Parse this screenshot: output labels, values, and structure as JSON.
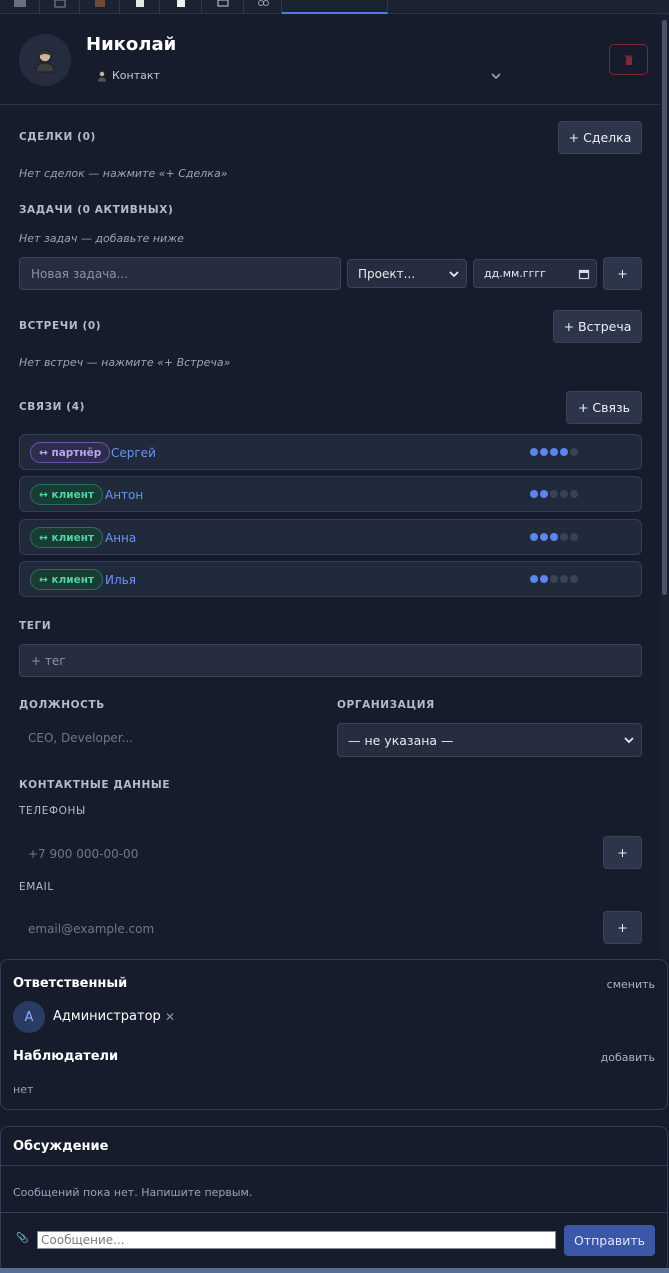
{
  "contact": {
    "name": "Николай",
    "type_label": "Контакт"
  },
  "deals": {
    "label": "СДЕЛКИ (0)",
    "add_button": "+ Сделка",
    "empty": "Нет сделок — нажмите «+ Сделка»"
  },
  "tasks": {
    "label": "ЗАДАЧИ (0 АКТИВНЫХ)",
    "empty": "Нет задач — добавьте ниже",
    "new_placeholder": "Новая задача...",
    "project_select": "Проект...",
    "date_placeholder": "дд.мм.гггг",
    "add_button": "+"
  },
  "meetings": {
    "label": "ВСТРЕЧИ (0)",
    "add_button": "+ Встреча",
    "empty": "Нет встреч — нажмите «+ Встреча»"
  },
  "links": {
    "label": "СВЯЗИ (4)",
    "add_button": "+ Связь",
    "items": [
      {
        "badge": "↔ партнёр",
        "kind": "partner",
        "name": "Сергей",
        "strength": 4
      },
      {
        "badge": "↔ клиент",
        "kind": "client",
        "name": "Антон",
        "strength": 2
      },
      {
        "badge": "↔ клиент",
        "kind": "client",
        "name": "Анна",
        "strength": 3
      },
      {
        "badge": "↔ клиент",
        "kind": "client",
        "name": "Илья",
        "strength": 2
      }
    ],
    "strength_max": 5
  },
  "tags": {
    "label": "ТЕГИ",
    "placeholder": "+ тег"
  },
  "position": {
    "label": "ДОЛЖНОСТЬ",
    "placeholder": "CEO, Developer..."
  },
  "organization": {
    "label": "ОРГАНИЗАЦИЯ",
    "value": "— не указана —"
  },
  "contact_data": {
    "label": "КОНТАКТНЫЕ ДАННЫЕ",
    "phones_label": "ТЕЛЕФОНЫ",
    "phone_placeholder": "+7 900 000-00-00",
    "email_label": "EMAIL",
    "email_placeholder": "email@example.com",
    "add_button": "+"
  },
  "responsible": {
    "title": "Ответственный",
    "change_link": "сменить",
    "avatar_letter": "А",
    "user": "Администратор",
    "remove": "✕"
  },
  "watchers": {
    "title": "Наблюдатели",
    "add_link": "добавить",
    "empty": "нет"
  },
  "discussion": {
    "title": "Обсуждение",
    "empty": "Сообщений пока нет. Напишите первым.",
    "attach": "📎",
    "message_placeholder": "Сообщение...",
    "send_button": "Отправить"
  },
  "colors": {
    "accent": "#4e7cf0",
    "danger": "#7d2b33",
    "partner": "#b6a7f3",
    "client": "#4fd4a2"
  }
}
